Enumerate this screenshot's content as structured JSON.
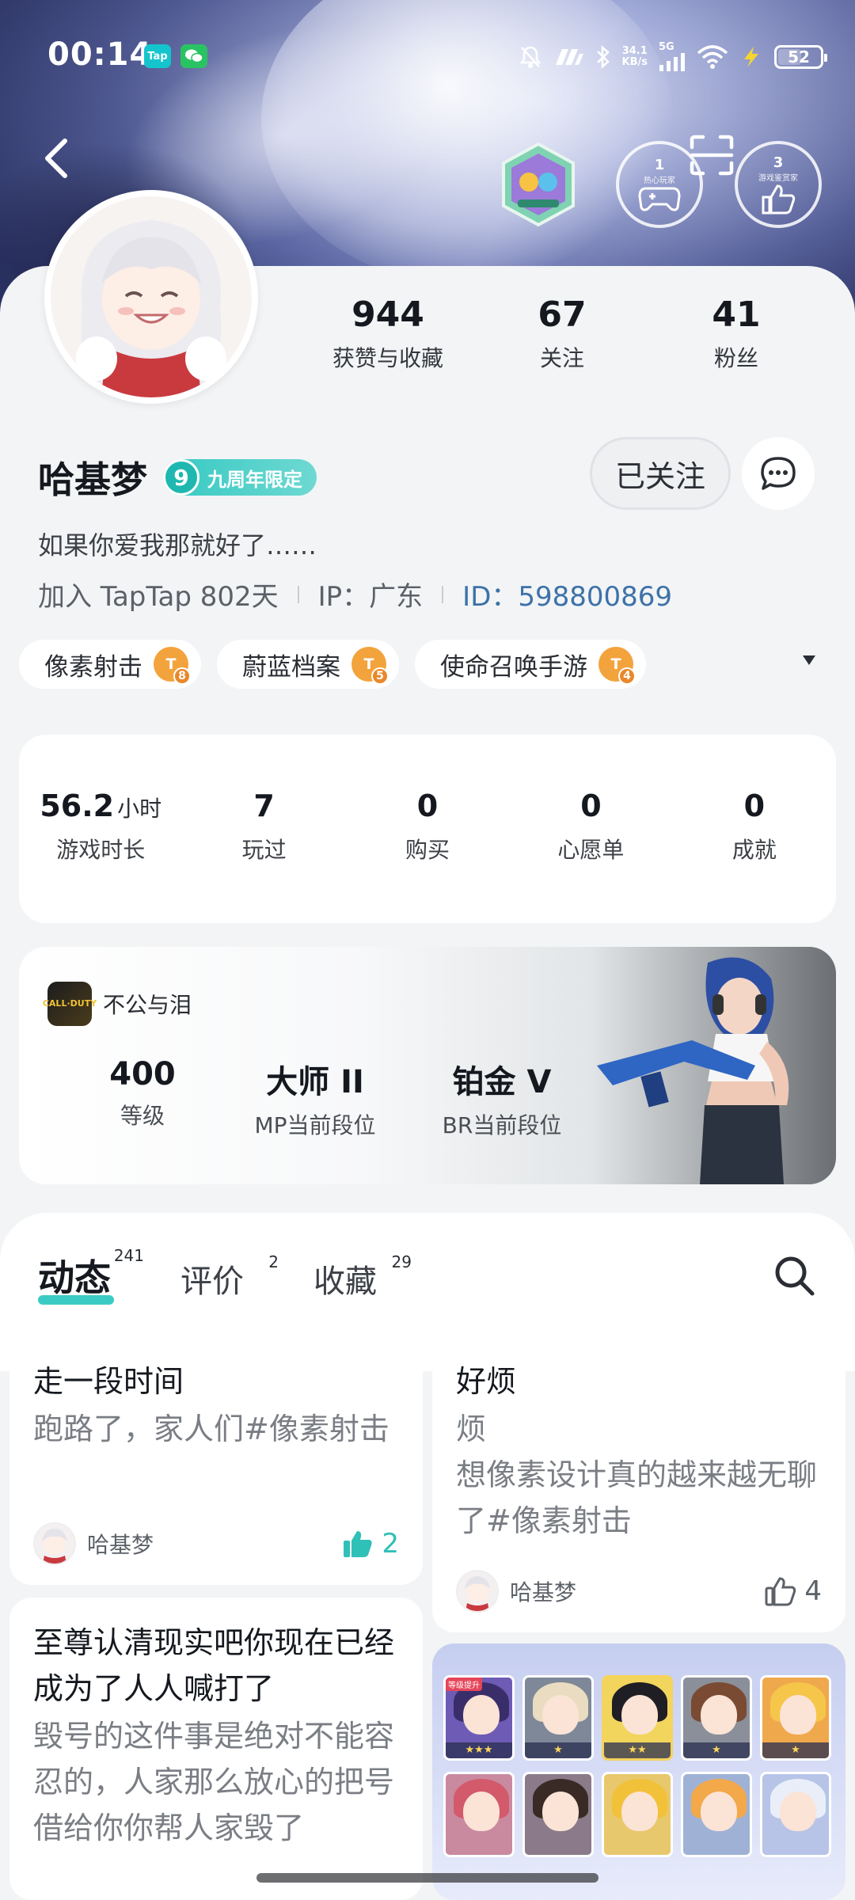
{
  "status_bar": {
    "time": "00:14",
    "app1": "Tap",
    "speed_value": "34.1",
    "speed_unit": "KB/s",
    "network": "5G",
    "battery": "52"
  },
  "header": {
    "circle_badge_1_num": "1",
    "circle_badge_1_text": "热心玩家",
    "circle_badge_2_num": "3",
    "circle_badge_2_text": "游戏鉴赏家"
  },
  "profile": {
    "stats": [
      {
        "value": "944",
        "label": "获赞与收藏"
      },
      {
        "value": "67",
        "label": "关注"
      },
      {
        "value": "41",
        "label": "粉丝"
      }
    ],
    "username": "哈基梦",
    "anniversary_badge_num": "9",
    "anniversary_badge_text": "九周年限定",
    "follow_button": "已关注",
    "bio": "如果你爱我那就好了……",
    "joined": "加入 TapTap 802天",
    "ip": "IP：广东",
    "user_id": "ID：598800869",
    "tags": [
      {
        "name": "像素射击",
        "level": "8"
      },
      {
        "name": "蔚蓝档案",
        "level": "5"
      },
      {
        "name": "使命召唤手游",
        "level": "4"
      }
    ]
  },
  "game_stats": [
    {
      "value": "56.2",
      "unit": "小时",
      "label": "游戏时长"
    },
    {
      "value": "7",
      "unit": "",
      "label": "玩过"
    },
    {
      "value": "0",
      "unit": "",
      "label": "购买"
    },
    {
      "value": "0",
      "unit": "",
      "label": "心愿单"
    },
    {
      "value": "0",
      "unit": "",
      "label": "成就"
    }
  ],
  "game_card": {
    "icon_text": "CALL·DUTY",
    "player_name": "不公与泪",
    "stats": [
      {
        "value": "400",
        "label": "等级"
      },
      {
        "value": "大师 II",
        "label": "MP当前段位"
      },
      {
        "value": "铂金 V",
        "label": "BR当前段位"
      }
    ]
  },
  "tabs": [
    {
      "label": "动态",
      "count": "241"
    },
    {
      "label": "评价",
      "count": "2"
    },
    {
      "label": "收藏",
      "count": "29"
    }
  ],
  "posts": [
    {
      "title": "走一段时间",
      "body": "跑路了，家人们#像素射击",
      "author": "哈基梦",
      "likes": "2"
    },
    {
      "title": "好烦",
      "body": "烦\n想像素设计真的越来越无聊了#像素射击",
      "author": "哈基梦",
      "likes": "4"
    },
    {
      "title": "至尊认清现实吧你现在已经成为了人人喊打了",
      "body": "毁号的这件事是绝对不能容忍的，人家那么放心的把号借给你你帮人家毁了"
    }
  ],
  "gallery": {
    "first_label": "等级提升"
  },
  "colors": {
    "accent": "#3ccbc4",
    "id_link": "#3c72a8",
    "tag_level": "#f3a33c"
  }
}
